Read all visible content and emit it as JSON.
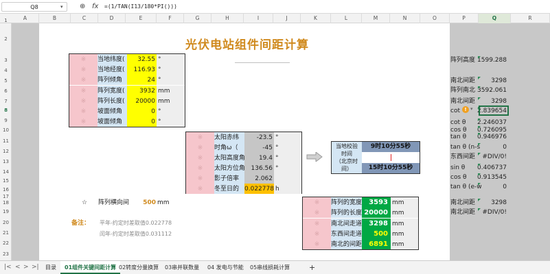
{
  "formula_bar": {
    "name_box": "Q8",
    "zoom_icon": "⊕",
    "fx": "fx",
    "formula": "=(1/TAN(I13/180*PI()))"
  },
  "columns": [
    "A",
    "B",
    "C",
    "D",
    "E",
    "F",
    "G",
    "H",
    "I",
    "J",
    "K",
    "L",
    "M",
    "N",
    "O",
    "P",
    "Q",
    "R"
  ],
  "rows": [
    "1",
    "2",
    "3",
    "4",
    "5",
    "6",
    "7",
    "8",
    "9",
    "10",
    "11",
    "12",
    "13",
    "14",
    "15",
    "16",
    "17",
    "18",
    "19",
    "20",
    "21",
    "22",
    "23"
  ],
  "title": "光伏电站组件间距计算",
  "input_block": [
    {
      "mark": "※",
      "label": "当地纬度(",
      "value": "32.55",
      "unit": "°"
    },
    {
      "mark": "※",
      "label": "当地经度(",
      "value": "116.93",
      "unit": "°"
    },
    {
      "mark": "※",
      "label": "阵列倾角",
      "value": "24",
      "unit": "°"
    },
    {
      "mark": "※",
      "label": "阵列宽度(",
      "value": "3932",
      "unit": "mm"
    },
    {
      "mark": "※",
      "label": "阵列长度(",
      "value": "20000",
      "unit": "mm"
    },
    {
      "mark": "※",
      "label": "坡面倾角",
      "value": "0",
      "unit": "°"
    },
    {
      "mark": "※",
      "label": "坡面倾角",
      "value": "0",
      "unit": "°"
    }
  ],
  "sun_block": [
    {
      "mark": "※",
      "label": "太阳赤纬",
      "value": "-23.5",
      "unit": "°"
    },
    {
      "mark": "※",
      "label": "时角ω（",
      "value": "-45",
      "unit": "°"
    },
    {
      "mark": "※",
      "label": "太阳高度角",
      "value": "19.4",
      "unit": "°"
    },
    {
      "mark": "※",
      "label": "太阳方位角",
      "value": "136.56",
      "unit": "°"
    },
    {
      "mark": "※",
      "label": "影子倍率",
      "value": "2.062",
      "unit": ""
    },
    {
      "mark": "※",
      "label": "冬至日的",
      "value": "0.022778",
      "unit": "h"
    }
  ],
  "time_block": {
    "label": "当地校验时间（北京时间）",
    "label_lines": [
      "当地校验",
      "时间",
      "（北京时",
      "间）"
    ],
    "top": "9时10分55秒",
    "bottom": "15时10分55秒"
  },
  "spacing": {
    "star": "☆",
    "label": "阵列横向间",
    "value": "500",
    "unit": "mm"
  },
  "notes": {
    "label": "备注：",
    "line1": "平年-约定时差取值0.022778",
    "line2": "闰年-约定时差取值0.031112"
  },
  "result_block": [
    {
      "mark": "※",
      "label": "阵列的宽度",
      "value": "3593",
      "unit": "mm",
      "yellow": false
    },
    {
      "mark": "※",
      "label": "阵列的长度",
      "value": "20000",
      "unit": "mm",
      "yellow": false
    },
    {
      "mark": "※",
      "label": "南北间走道",
      "value": "3298",
      "unit": "mm",
      "yellow": false
    },
    {
      "mark": "※",
      "label": "东西间走道",
      "value": "500",
      "unit": "mm",
      "yellow": true
    },
    {
      "mark": "※",
      "label": "南北的间距",
      "value": "6891",
      "unit": "mm",
      "yellow": true
    }
  ],
  "right_panel": [
    {
      "label": "阵列高度",
      "value": "1599.288"
    },
    {
      "label": "南北间距",
      "value": "3298"
    },
    {
      "label": "阵列南北",
      "value": "3592.061"
    },
    {
      "label": "南北间距",
      "value": "3298"
    },
    {
      "label": "cot",
      "value": "2.839654"
    },
    {
      "label": "cot θ",
      "value": "2.246037"
    },
    {
      "label": "cos θ",
      "value": "0.726095"
    },
    {
      "label": "tan θ",
      "value": "0.946976"
    },
    {
      "label": "tan θ (n-s",
      "value": "0"
    },
    {
      "label": "东西间距",
      "value": "#DIV/0!"
    },
    {
      "label": "sin θ",
      "value": "0.406737"
    },
    {
      "label": "cos θ",
      "value": "0.913545"
    },
    {
      "label": "tan θ (e-w",
      "value": "0"
    },
    {
      "label": "南北间距",
      "value": "3298"
    },
    {
      "label": "南北间距",
      "value": "#DIV/0!"
    }
  ],
  "tabs": [
    "目录",
    "01组件关键间距计算",
    "02转度分量换算",
    "03串并联数量",
    "04 发电与节能",
    "05串线损耗计算"
  ],
  "add_tab": "+",
  "colors": {
    "accent": "#217346",
    "title": "#d08a1e",
    "input": "#ffff00",
    "result": "#00a844",
    "pink": "#f6c6cc"
  }
}
